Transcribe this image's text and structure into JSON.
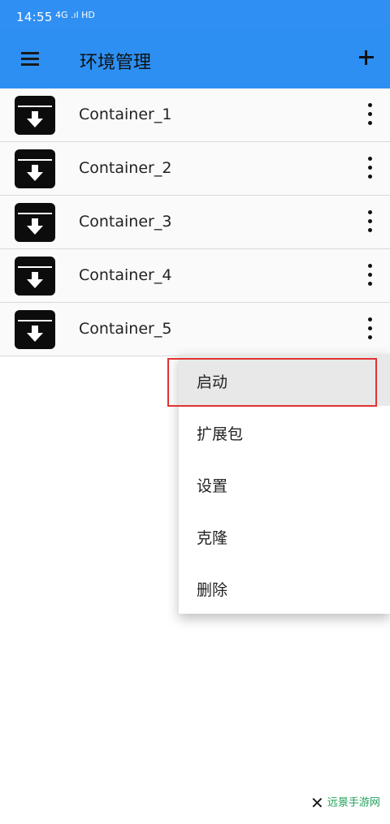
{
  "status": {
    "time": "14:55",
    "icons": "4G .ıl HD"
  },
  "appbar": {
    "title": "环境管理"
  },
  "containers": [
    {
      "name": "Container_1"
    },
    {
      "name": "Container_2"
    },
    {
      "name": "Container_3"
    },
    {
      "name": "Container_4"
    },
    {
      "name": "Container_5"
    }
  ],
  "menu": {
    "items": [
      "启动",
      "扩展包",
      "设置",
      "克隆",
      "删除"
    ],
    "highlighted": "启动"
  },
  "watermark": {
    "text": "远景手游网"
  },
  "colors": {
    "appbar": "#2d8ff2",
    "highlight": "#e03333"
  }
}
